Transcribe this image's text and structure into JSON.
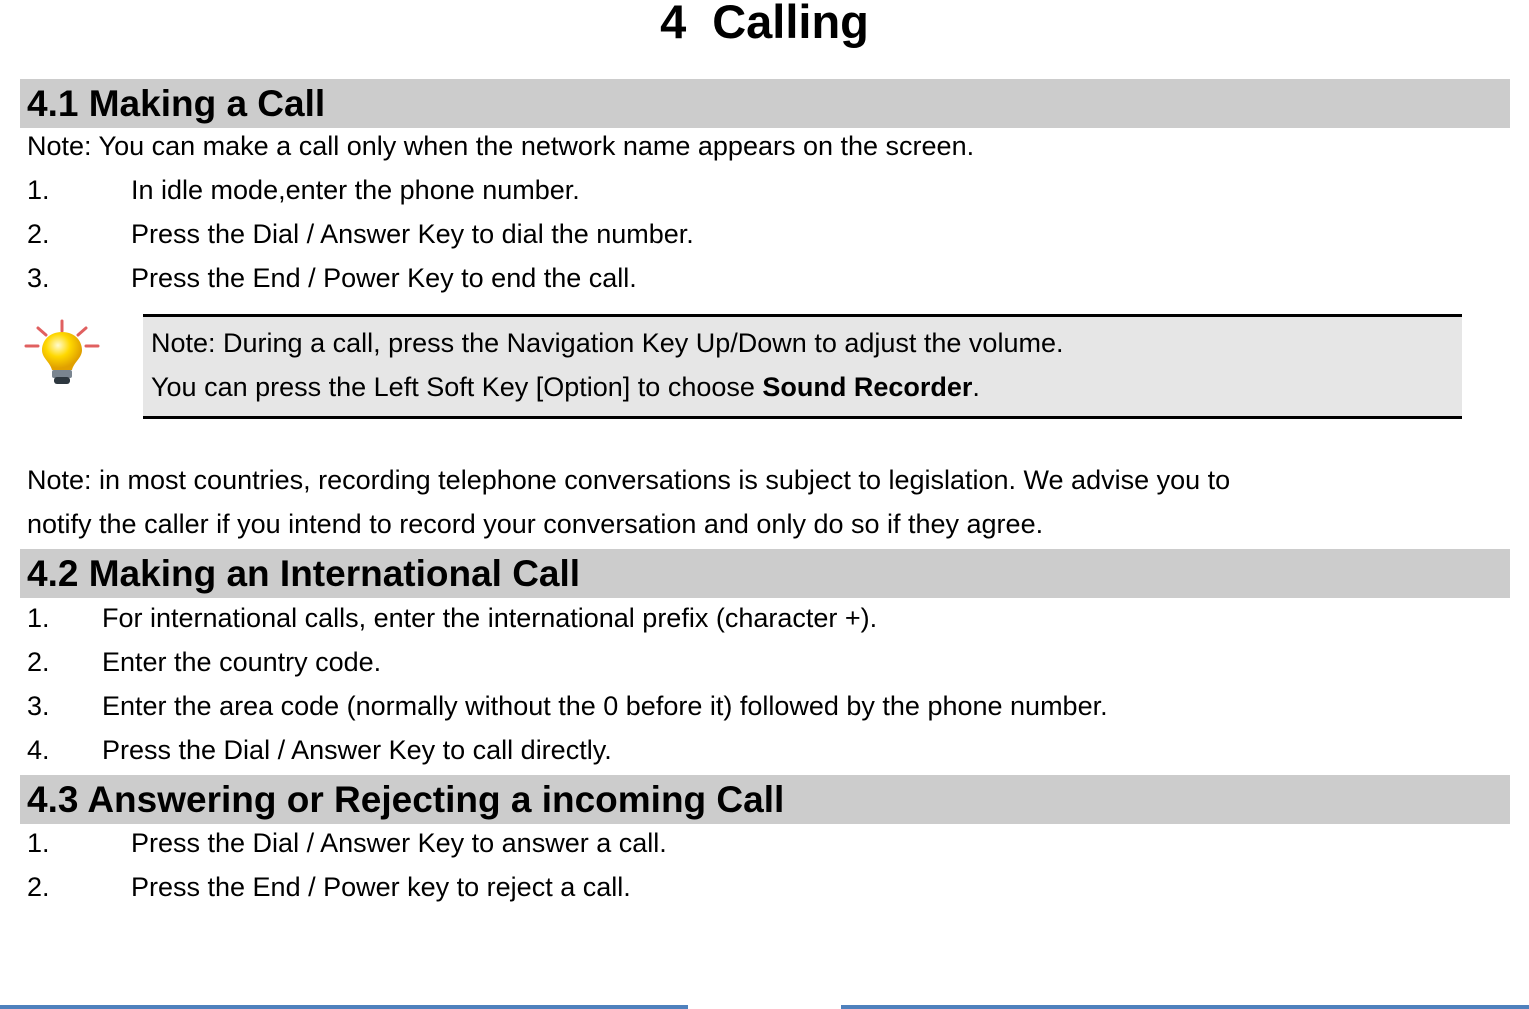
{
  "chapter": {
    "number": "4",
    "title": "Calling"
  },
  "sections": [
    {
      "heading": "4.1 Making a Call",
      "note": "Note: You can make a call only when the network name appears on the screen.",
      "steps": [
        {
          "n": "1.",
          "text": "In idle mode,enter the phone number."
        },
        {
          "n": "2.",
          "text": "Press the Dial / Answer Key to dial the number."
        },
        {
          "n": "3.",
          "text": "Press the End / Power Key to end the call."
        }
      ],
      "tip": {
        "icon": "lightbulb-icon",
        "line1": "Note: During a call, press the Navigation Key Up/Down to adjust the volume.",
        "line2_prefix": "You can press the Left Soft Key [Option] to choose ",
        "line2_bold": "Sound Recorder",
        "line2_suffix": "."
      },
      "legal_note_line1": "Note: in most countries, recording telephone conversations is subject to legislation. We advise you to",
      "legal_note_line2": "notify the caller if you intend to record your conversation and only do so if they agree."
    },
    {
      "heading": "4.2 Making an International Call",
      "steps": [
        {
          "n": "1.",
          "text": "For international calls, enter the international prefix (character +)."
        },
        {
          "n": "2.",
          "text": "Enter the country code."
        },
        {
          "n": "3.",
          "text": "Enter the area code (normally without the 0 before it) followed by the phone number."
        },
        {
          "n": "4.",
          "text": "Press the Dial / Answer Key to call directly."
        }
      ]
    },
    {
      "heading": "4.3 Answering or Rejecting a incoming Call",
      "steps": [
        {
          "n": "1.",
          "text": "Press the Dial / Answer Key to answer a call."
        },
        {
          "n": "2.",
          "text": "Press the End / Power key to reject a call."
        }
      ]
    }
  ],
  "colors": {
    "section_bar": "#cccccc",
    "tip_box": "#e6e6e6",
    "footer_rule": "#4f81bd"
  }
}
